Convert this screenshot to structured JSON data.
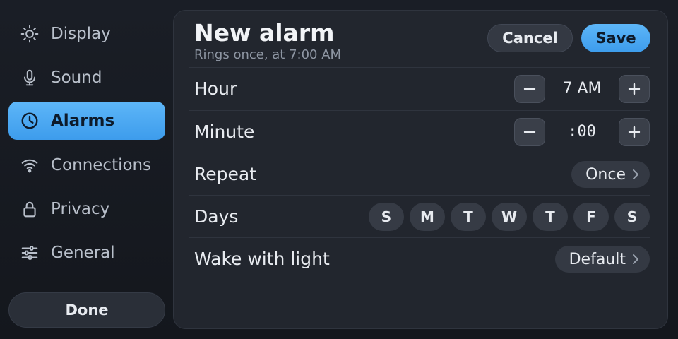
{
  "sidebar": {
    "items": [
      {
        "label": "Display",
        "icon": "sun-icon"
      },
      {
        "label": "Sound",
        "icon": "microphone-icon"
      },
      {
        "label": "Alarms",
        "icon": "clock-icon",
        "active": true
      },
      {
        "label": "Connections",
        "icon": "wifi-icon"
      },
      {
        "label": "Privacy",
        "icon": "lock-icon"
      },
      {
        "label": "General",
        "icon": "sliders-icon"
      }
    ],
    "done_label": "Done"
  },
  "panel": {
    "title": "New alarm",
    "subtitle": "Rings once, at 7:00 AM",
    "cancel_label": "Cancel",
    "save_label": "Save",
    "hour": {
      "label": "Hour",
      "value": "7 AM"
    },
    "minute": {
      "label": "Minute",
      "value": ":00"
    },
    "repeat": {
      "label": "Repeat",
      "value": "Once"
    },
    "days": {
      "label": "Days",
      "items": [
        "S",
        "M",
        "T",
        "W",
        "T",
        "F",
        "S"
      ]
    },
    "wake_light": {
      "label": "Wake with light",
      "value": "Default"
    }
  },
  "colors": {
    "accent": "#4aa8f2",
    "background": "#15181f",
    "panel": "#22262e"
  }
}
